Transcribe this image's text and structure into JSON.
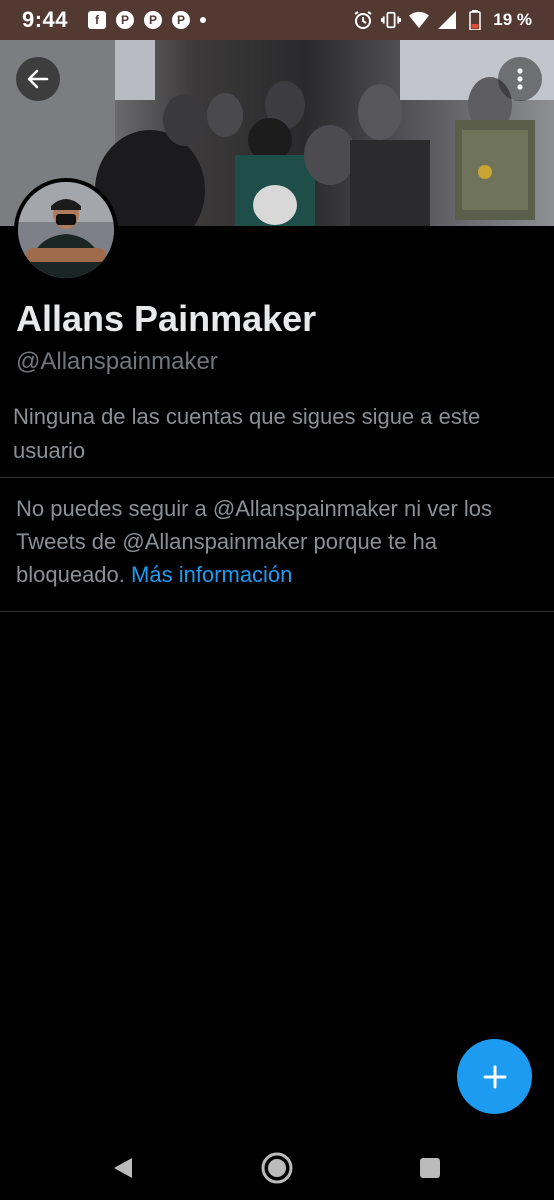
{
  "status_bar": {
    "time": "9:44",
    "battery_percent": "19 %",
    "notifications": [
      "facebook-icon",
      "pinterest-icon",
      "pinterest-icon",
      "pinterest-icon"
    ],
    "background": "#523a33"
  },
  "profile": {
    "display_name": "Allans Painmaker",
    "handle": "@Allanspainmaker",
    "mutual_text": "Ninguna de las cuentas que sigues sigue a este usuario",
    "blocked_text": "No puedes seguir a @Allanspainmaker ni ver los Tweets de @Allanspainmaker porque te ha bloqueado.",
    "blocked_link": "Más información"
  },
  "colors": {
    "accent": "#1d9bf0",
    "background": "#000000",
    "primary_text": "#e7e9ea",
    "secondary_text": "#71767b",
    "divider": "#2f3336"
  },
  "fab": {
    "icon": "plus-icon"
  },
  "nav": {
    "icons": [
      "nav-back-icon",
      "nav-home-icon",
      "nav-recents-icon"
    ]
  }
}
